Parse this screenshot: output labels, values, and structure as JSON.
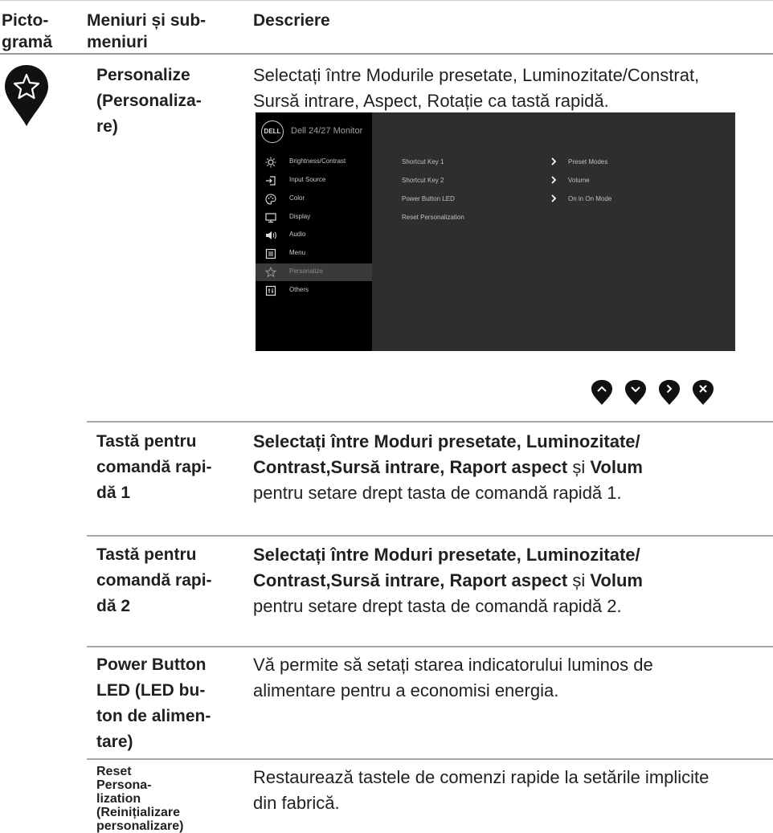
{
  "header": {
    "col1": [
      "Picto-",
      "gramă"
    ],
    "col2": [
      "Meniuri și sub-",
      "meniuri"
    ],
    "col3": "Descriere"
  },
  "personalize": {
    "icon": "star-pin-icon",
    "title": [
      "Personalize",
      "(Personaliza-",
      "re)"
    ],
    "description": [
      "Selectați între Modurile presetate, Luminozitate/Constrat,",
      "Sursă intrare, Aspect, Rotație ca tastă rapidă."
    ]
  },
  "osd": {
    "logo": "DELL",
    "title": "Dell 24/27 Monitor",
    "menu": [
      {
        "label": "Brightness/Contrast",
        "icon": "brightness-icon"
      },
      {
        "label": "Input Source",
        "icon": "input-source-icon"
      },
      {
        "label": "Color",
        "icon": "color-icon"
      },
      {
        "label": "Display",
        "icon": "display-icon"
      },
      {
        "label": "Audio",
        "icon": "audio-icon"
      },
      {
        "label": "Menu",
        "icon": "menu-icon"
      },
      {
        "label": "Personalize",
        "icon": "star-icon",
        "selected": true
      },
      {
        "label": "Others",
        "icon": "others-icon"
      }
    ],
    "items": [
      {
        "label": "Shortcut Key 1",
        "value": "Preset Modes"
      },
      {
        "label": "Shortcut Key 2",
        "value": "Volume"
      },
      {
        "label": "Power Button LED",
        "value": "On in On Mode"
      },
      {
        "label": "Reset Personalization",
        "value": ""
      }
    ]
  },
  "nav_buttons": [
    "up-icon",
    "down-icon",
    "right-icon",
    "close-icon"
  ],
  "rows": [
    {
      "title": [
        "Tastă pentru",
        "comandă rapi-",
        "dă 1"
      ],
      "line1": "Selectați între Moduri presetate, Luminozitate/",
      "line2_bold": "Contrast,Sursă intrare, Raport aspect",
      "line2_mid": " și ",
      "line2_end": "Volum",
      "line3": "pentru setare drept tasta de comandă rapidă 1."
    },
    {
      "title": [
        "Tastă pentru",
        "comandă rapi-",
        "dă 2"
      ],
      "line1": "Selectați între Moduri presetate, Luminozitate/",
      "line2_bold": "Contrast,Sursă intrare, Raport aspect",
      "line2_mid": " și ",
      "line2_end": "Volum",
      "line3": "pentru setare drept tasta de comandă rapidă 2."
    },
    {
      "title": [
        "Power Button",
        "LED (LED bu-",
        "ton de alimen-",
        "tare)"
      ],
      "desc": [
        "Vă permite să setați starea indicatorului luminos de",
        "alimentare pentru a economisi energia."
      ]
    },
    {
      "title": [
        "Reset",
        "Persona-",
        "lization",
        "(Reinițializare",
        "personalizare)"
      ],
      "desc": [
        "Restaurează tastele de comenzi rapide la setările implicite",
        "din fabrică."
      ]
    }
  ]
}
